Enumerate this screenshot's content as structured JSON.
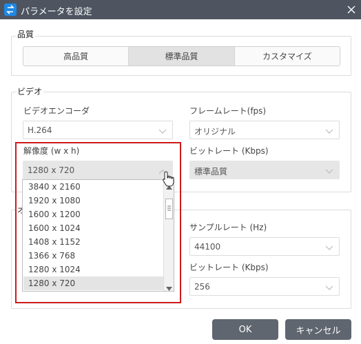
{
  "window": {
    "title": "パラメータを設定",
    "icon": "app-logo-icon",
    "close_icon": "close-icon"
  },
  "quality": {
    "label": "品質",
    "options": [
      "高品質",
      "標準品質",
      "カスタマイズ"
    ],
    "selected": "標準品質"
  },
  "video": {
    "label": "ビデオ",
    "encoder_label": "ビデオエンコーダ",
    "encoder_value": "H.264",
    "framerate_label": "フレームレート(fps)",
    "framerate_value": "オリジナル",
    "resolution_label": "解像度 (w x h)",
    "resolution_value": "1280 x 720",
    "bitrate_label": "ビットレート (Kbps)",
    "bitrate_value": "標準品質"
  },
  "resolution_dropdown": {
    "options": [
      "3840 x 2160",
      "1920 x 1080",
      "1600 x 1200",
      "1600 x 1024",
      "1408 x 1152",
      "1366 x 768",
      "1280 x 1024",
      "1280 x 720"
    ],
    "selected": "1280 x 720"
  },
  "audio": {
    "label_partial": "オ",
    "samplerate_label": "サンプルレート (Hz)",
    "samplerate_value": "44100",
    "bitrate_label": "ビットレート (Kbps)",
    "bitrate_value": "256"
  },
  "buttons": {
    "ok": "OK",
    "cancel": "キャンセル"
  },
  "colors": {
    "titlebar": "#4e5560",
    "highlight": "#cc1a1a",
    "button": "#5f6670",
    "accent": "#1e88e5"
  }
}
